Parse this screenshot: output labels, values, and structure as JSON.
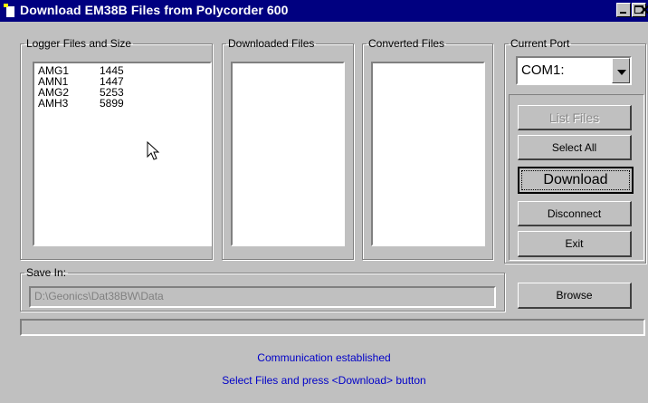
{
  "window": {
    "title": "Download EM38B Files from Polycorder 600",
    "icon": "app-icon"
  },
  "logger": {
    "label": "Logger Files and Size",
    "files": [
      {
        "name": "AMG1",
        "size": "1445"
      },
      {
        "name": "AMN1",
        "size": "1447"
      },
      {
        "name": "AMG2",
        "size": "5253"
      },
      {
        "name": "AMH3",
        "size": "5899"
      }
    ]
  },
  "downloaded": {
    "label": "Downloaded Files"
  },
  "converted": {
    "label": "Converted Files"
  },
  "port": {
    "label": "Current Port",
    "value": "COM1:"
  },
  "buttons": {
    "list_files": "List Files",
    "select_all": "Select All",
    "download": "Download",
    "disconnect": "Disconnect",
    "exit": "Exit",
    "browse": "Browse"
  },
  "save_in": {
    "label": "Save In:",
    "path": "D:\\Geonics\\Dat38BW\\Data"
  },
  "status": {
    "line1": "Communication established",
    "line2": "Select Files and press <Download> button"
  }
}
